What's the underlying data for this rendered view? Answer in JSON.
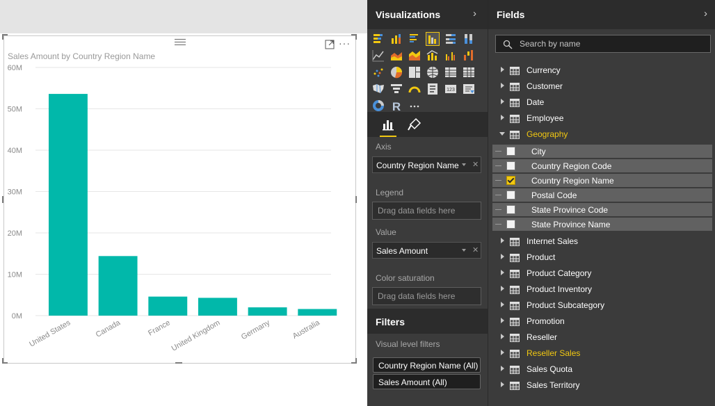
{
  "visual": {
    "title": "Sales Amount by Country Region Name",
    "bar_color": "#01b8aa"
  },
  "chart_data": {
    "type": "bar",
    "title": "Sales Amount by Country Region Name",
    "categories": [
      "United States",
      "Canada",
      "France",
      "United Kingdom",
      "Germany",
      "Australia"
    ],
    "values": [
      53.6,
      14.4,
      4.6,
      4.3,
      2.0,
      1.6
    ],
    "ylim": [
      0,
      60
    ],
    "yticks": [
      "0M",
      "10M",
      "20M",
      "30M",
      "40M",
      "50M",
      "60M"
    ],
    "grid": true
  },
  "visualizations": {
    "title": "Visualizations",
    "icons": [
      "stacked-bar-chart-icon",
      "stacked-column-chart-icon",
      "clustered-bar-chart-icon",
      "clustered-column-chart-icon",
      "100-percent-bar-chart-icon",
      "100-percent-column-chart-icon",
      "line-chart-icon",
      "area-chart-icon",
      "stacked-area-chart-icon",
      "line-and-column-chart-icon",
      "line-and-clustered-column-chart-icon",
      "waterfall-chart-icon",
      "scatter-chart-icon",
      "pie-chart-icon",
      "treemap-icon",
      "map-icon",
      "table-icon",
      "matrix-icon",
      "filled-map-icon",
      "funnel-icon",
      "gauge-icon",
      "multi-row-card-icon",
      "card-icon",
      "slicer-icon",
      "donut-chart-icon",
      "r-visual-icon",
      "more-visuals-icon"
    ],
    "wells": {
      "axis_label": "Axis",
      "axis_value": "Country Region Name",
      "legend_label": "Legend",
      "legend_placeholder": "Drag data fields here",
      "value_label": "Value",
      "value_value": "Sales Amount",
      "saturation_label": "Color saturation",
      "saturation_placeholder": "Drag data fields here"
    }
  },
  "filters": {
    "title": "Filters",
    "visual_level_label": "Visual level filters",
    "items": [
      "Country Region Name (All)",
      "Sales Amount (All)"
    ]
  },
  "fields": {
    "title": "Fields",
    "search_placeholder": "Search by name",
    "tables_before": [
      "Currency",
      "Customer",
      "Date",
      "Employee"
    ],
    "expanded_table": "Geography",
    "columns": [
      {
        "label": "City",
        "checked": false
      },
      {
        "label": "Country Region Code",
        "checked": false
      },
      {
        "label": "Country Region Name",
        "checked": true
      },
      {
        "label": "Postal Code",
        "checked": false
      },
      {
        "label": "State Province Code",
        "checked": false
      },
      {
        "label": "State Province Name",
        "checked": false
      }
    ],
    "tables_after": [
      "Internet Sales",
      "Product",
      "Product Category",
      "Product Inventory",
      "Product Subcategory",
      "Promotion",
      "Reseller",
      "Reseller Sales",
      "Sales Quota",
      "Sales Territory"
    ],
    "highlight_color": "#f2c811"
  }
}
